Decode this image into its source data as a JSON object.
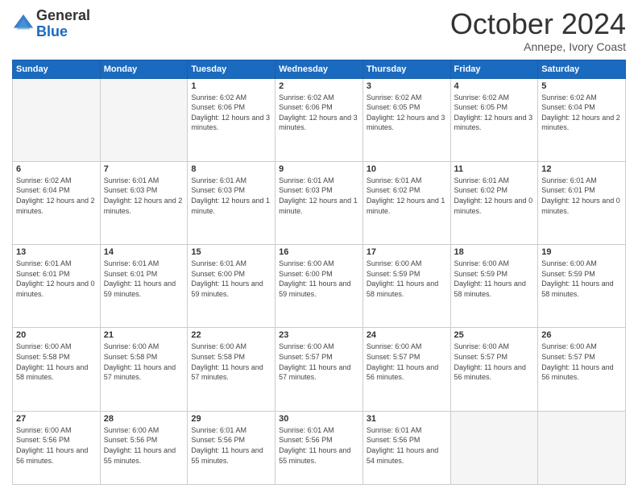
{
  "header": {
    "logo_general": "General",
    "logo_blue": "Blue",
    "month_title": "October 2024",
    "location": "Annepe, Ivory Coast"
  },
  "days_of_week": [
    "Sunday",
    "Monday",
    "Tuesday",
    "Wednesday",
    "Thursday",
    "Friday",
    "Saturday"
  ],
  "weeks": [
    [
      {
        "day": "",
        "info": ""
      },
      {
        "day": "",
        "info": ""
      },
      {
        "day": "1",
        "info": "Sunrise: 6:02 AM\nSunset: 6:06 PM\nDaylight: 12 hours and 3 minutes."
      },
      {
        "day": "2",
        "info": "Sunrise: 6:02 AM\nSunset: 6:06 PM\nDaylight: 12 hours and 3 minutes."
      },
      {
        "day": "3",
        "info": "Sunrise: 6:02 AM\nSunset: 6:05 PM\nDaylight: 12 hours and 3 minutes."
      },
      {
        "day": "4",
        "info": "Sunrise: 6:02 AM\nSunset: 6:05 PM\nDaylight: 12 hours and 3 minutes."
      },
      {
        "day": "5",
        "info": "Sunrise: 6:02 AM\nSunset: 6:04 PM\nDaylight: 12 hours and 2 minutes."
      }
    ],
    [
      {
        "day": "6",
        "info": "Sunrise: 6:02 AM\nSunset: 6:04 PM\nDaylight: 12 hours and 2 minutes."
      },
      {
        "day": "7",
        "info": "Sunrise: 6:01 AM\nSunset: 6:03 PM\nDaylight: 12 hours and 2 minutes."
      },
      {
        "day": "8",
        "info": "Sunrise: 6:01 AM\nSunset: 6:03 PM\nDaylight: 12 hours and 1 minute."
      },
      {
        "day": "9",
        "info": "Sunrise: 6:01 AM\nSunset: 6:03 PM\nDaylight: 12 hours and 1 minute."
      },
      {
        "day": "10",
        "info": "Sunrise: 6:01 AM\nSunset: 6:02 PM\nDaylight: 12 hours and 1 minute."
      },
      {
        "day": "11",
        "info": "Sunrise: 6:01 AM\nSunset: 6:02 PM\nDaylight: 12 hours and 0 minutes."
      },
      {
        "day": "12",
        "info": "Sunrise: 6:01 AM\nSunset: 6:01 PM\nDaylight: 12 hours and 0 minutes."
      }
    ],
    [
      {
        "day": "13",
        "info": "Sunrise: 6:01 AM\nSunset: 6:01 PM\nDaylight: 12 hours and 0 minutes."
      },
      {
        "day": "14",
        "info": "Sunrise: 6:01 AM\nSunset: 6:01 PM\nDaylight: 11 hours and 59 minutes."
      },
      {
        "day": "15",
        "info": "Sunrise: 6:01 AM\nSunset: 6:00 PM\nDaylight: 11 hours and 59 minutes."
      },
      {
        "day": "16",
        "info": "Sunrise: 6:00 AM\nSunset: 6:00 PM\nDaylight: 11 hours and 59 minutes."
      },
      {
        "day": "17",
        "info": "Sunrise: 6:00 AM\nSunset: 5:59 PM\nDaylight: 11 hours and 58 minutes."
      },
      {
        "day": "18",
        "info": "Sunrise: 6:00 AM\nSunset: 5:59 PM\nDaylight: 11 hours and 58 minutes."
      },
      {
        "day": "19",
        "info": "Sunrise: 6:00 AM\nSunset: 5:59 PM\nDaylight: 11 hours and 58 minutes."
      }
    ],
    [
      {
        "day": "20",
        "info": "Sunrise: 6:00 AM\nSunset: 5:58 PM\nDaylight: 11 hours and 58 minutes."
      },
      {
        "day": "21",
        "info": "Sunrise: 6:00 AM\nSunset: 5:58 PM\nDaylight: 11 hours and 57 minutes."
      },
      {
        "day": "22",
        "info": "Sunrise: 6:00 AM\nSunset: 5:58 PM\nDaylight: 11 hours and 57 minutes."
      },
      {
        "day": "23",
        "info": "Sunrise: 6:00 AM\nSunset: 5:57 PM\nDaylight: 11 hours and 57 minutes."
      },
      {
        "day": "24",
        "info": "Sunrise: 6:00 AM\nSunset: 5:57 PM\nDaylight: 11 hours and 56 minutes."
      },
      {
        "day": "25",
        "info": "Sunrise: 6:00 AM\nSunset: 5:57 PM\nDaylight: 11 hours and 56 minutes."
      },
      {
        "day": "26",
        "info": "Sunrise: 6:00 AM\nSunset: 5:57 PM\nDaylight: 11 hours and 56 minutes."
      }
    ],
    [
      {
        "day": "27",
        "info": "Sunrise: 6:00 AM\nSunset: 5:56 PM\nDaylight: 11 hours and 56 minutes."
      },
      {
        "day": "28",
        "info": "Sunrise: 6:00 AM\nSunset: 5:56 PM\nDaylight: 11 hours and 55 minutes."
      },
      {
        "day": "29",
        "info": "Sunrise: 6:01 AM\nSunset: 5:56 PM\nDaylight: 11 hours and 55 minutes."
      },
      {
        "day": "30",
        "info": "Sunrise: 6:01 AM\nSunset: 5:56 PM\nDaylight: 11 hours and 55 minutes."
      },
      {
        "day": "31",
        "info": "Sunrise: 6:01 AM\nSunset: 5:56 PM\nDaylight: 11 hours and 54 minutes."
      },
      {
        "day": "",
        "info": ""
      },
      {
        "day": "",
        "info": ""
      }
    ]
  ]
}
